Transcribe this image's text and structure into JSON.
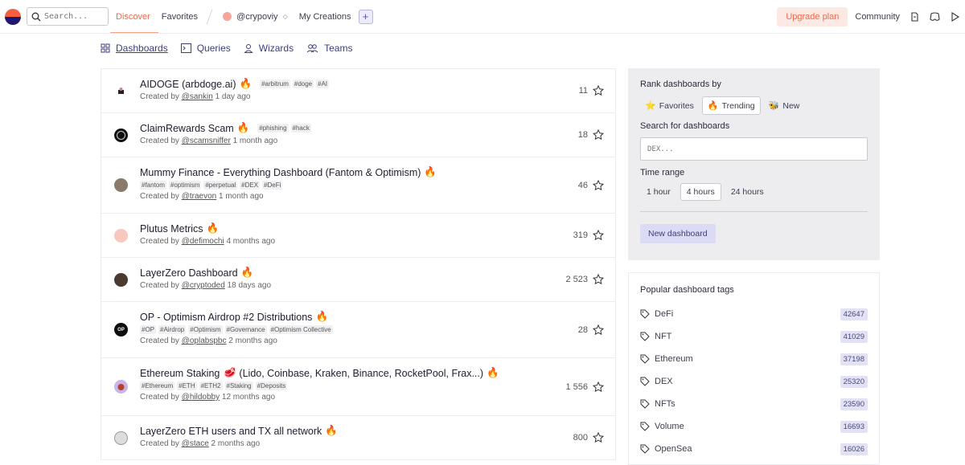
{
  "header": {
    "search_placeholder": "Search...",
    "nav_discover": "Discover",
    "nav_favorites": "Favorites",
    "username": "@crypoviy",
    "nav_my_creations": "My Creations",
    "upgrade_label": "Upgrade plan",
    "community_label": "Community"
  },
  "subnav": {
    "dashboards": "Dashboards",
    "queries": "Queries",
    "wizards": "Wizards",
    "teams": "Teams"
  },
  "dashboards": [
    {
      "title": "AIDOGE (arbdoge.ai)",
      "tags_inline": [
        "#arbitrum",
        "#doge",
        "#AI"
      ],
      "tags": [],
      "creator_prefix": "Created by ",
      "creator": "@sankin",
      "age": "1 day ago",
      "count": "11"
    },
    {
      "title": "ClaimRewards Scam",
      "tags_inline": [
        "#phishing",
        "#hack"
      ],
      "tags": [],
      "creator_prefix": "Created by ",
      "creator": "@scamsniffer",
      "age": "1 month ago",
      "count": "18"
    },
    {
      "title": "Mummy Finance - Everything Dashboard (Fantom & Optimism)",
      "tags_inline": [],
      "tags": [
        "#fantom",
        "#optimism",
        "#perpetual",
        "#DEX",
        "#DeFi"
      ],
      "creator_prefix": "Created by ",
      "creator": "@traevon",
      "age": "1 month ago",
      "count": "46"
    },
    {
      "title": "Plutus Metrics",
      "tags_inline": [],
      "tags": [],
      "creator_prefix": "Created by ",
      "creator": "@defimochi",
      "age": "4 months ago",
      "count": "319"
    },
    {
      "title": "LayerZero Dashboard",
      "tags_inline": [],
      "tags": [],
      "creator_prefix": "Created by ",
      "creator": "@cryptoded",
      "age": "18 days ago",
      "count": "2 523"
    },
    {
      "title": "OP - Optimism Airdrop #2 Distributions",
      "tags_inline": [],
      "tags": [
        "#OP",
        "#Airdrop",
        "#Optimism",
        "#Governance",
        "#Optimism Collective"
      ],
      "creator_prefix": "Created by ",
      "creator": "@oplabspbc",
      "age": "2 months ago",
      "count": "28"
    },
    {
      "title": "Ethereum Staking",
      "title_rest": "(Lido, Coinbase, Kraken, Binance, RocketPool, Frax...)",
      "tags_inline": [],
      "tags": [
        "#Ethereum",
        "#ETH",
        "#ETH2",
        "#Staking",
        "#Deposits"
      ],
      "creator_prefix": "Created by ",
      "creator": "@hildobby",
      "age": "12 months ago",
      "count": "1 556"
    },
    {
      "title": "LayerZero ETH users and TX all network",
      "tags_inline": [],
      "tags": [],
      "creator_prefix": "Created by ",
      "creator": "@stace",
      "age": "2 months ago",
      "count": "800"
    }
  ],
  "rank_panel": {
    "heading": "Rank dashboards by",
    "favorites": "Favorites",
    "trending": "Trending",
    "new": "New",
    "search_heading": "Search for dashboards",
    "search_placeholder": "DEX...",
    "time_heading": "Time range",
    "time_1h": "1 hour",
    "time_4h": "4 hours",
    "time_24h": "24 hours",
    "new_dashboard": "New dashboard"
  },
  "tags_panel": {
    "heading": "Popular dashboard tags",
    "tags": [
      {
        "name": "DeFi",
        "count": "42647"
      },
      {
        "name": "NFT",
        "count": "41029"
      },
      {
        "name": "Ethereum",
        "count": "37198"
      },
      {
        "name": "DEX",
        "count": "25320"
      },
      {
        "name": "NFTs",
        "count": "23590"
      },
      {
        "name": "Volume",
        "count": "16693"
      },
      {
        "name": "OpenSea",
        "count": "16026"
      }
    ]
  },
  "colors": {
    "accent": "#f06a4b",
    "link": "#3d3d7a",
    "panel": "#ededf0"
  }
}
